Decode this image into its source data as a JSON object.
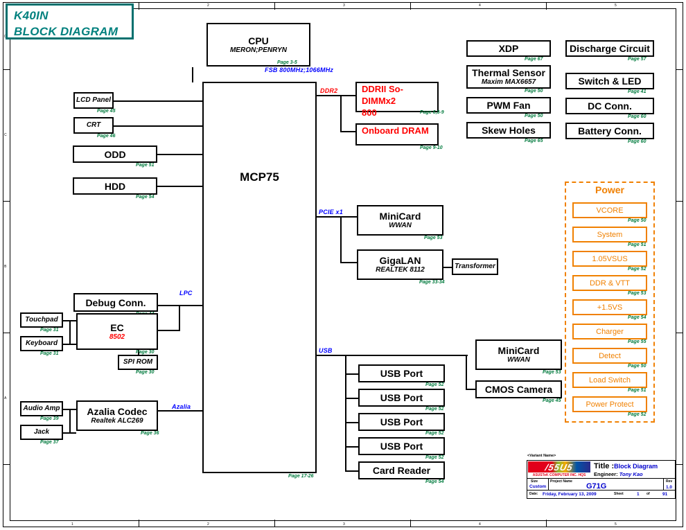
{
  "sheet": {
    "title_line1": "K40IN",
    "title_line2": "BLOCK DIAGRAM"
  },
  "blocks": {
    "cpu": {
      "name": "CPU",
      "sub": "MERON;PENRYN",
      "page": "Page 3-5"
    },
    "mcp75": {
      "name": "MCP75",
      "sub": "",
      "page": "Page 17-26"
    },
    "lcd_panel": {
      "name": "LCD Panel",
      "sub": "",
      "page": "Page 45"
    },
    "crt": {
      "name": "CRT",
      "sub": "",
      "page": "Page 46"
    },
    "odd": {
      "name": "ODD",
      "sub": "",
      "page": "Page 51"
    },
    "hdd": {
      "name": "HDD",
      "sub": "",
      "page": "Page 54"
    },
    "ddrii": {
      "name": "DDRII So-DIMMx2",
      "sub": "800",
      "page": "Page 6,8-9"
    },
    "onboard_dram": {
      "name": "Onboard DRAM",
      "sub": "",
      "page": "Page 9-10"
    },
    "xdp": {
      "name": "XDP",
      "sub": "",
      "page": "Page 67"
    },
    "thermal_sensor": {
      "name": "Thermal Sensor",
      "sub": "Maxim MAX6657",
      "page": "Page 50"
    },
    "pwm_fan": {
      "name": "PWM Fan",
      "sub": "",
      "page": "Page 50"
    },
    "skew_holes": {
      "name": "Skew Holes",
      "sub": "",
      "page": "Page 65"
    },
    "discharge": {
      "name": "Discharge Circuit",
      "sub": "",
      "page": "Page 57"
    },
    "switch_led": {
      "name": "Switch & LED",
      "sub": "",
      "page": "Page 41"
    },
    "dc_conn": {
      "name": "DC Conn.",
      "sub": "",
      "page": "Page 60"
    },
    "battery_conn": {
      "name": "Battery Conn.",
      "sub": "",
      "page": "Page 60"
    },
    "minicard_pcie": {
      "name": "MiniCard",
      "sub": "WWAN",
      "page": "Page 53"
    },
    "gigalan": {
      "name": "GigaLAN",
      "sub": "REALTEK 8112",
      "page": "Page 33-34"
    },
    "transformer": {
      "name": "Transformer",
      "sub": "",
      "page": ""
    },
    "debug_conn": {
      "name": "Debug Conn.",
      "sub": "",
      "page": "Page 44"
    },
    "touchpad": {
      "name": "Touchpad",
      "sub": "",
      "page": "Page 31"
    },
    "keyboard": {
      "name": "Keyboard",
      "sub": "",
      "page": "Page 31"
    },
    "ec": {
      "name": "EC",
      "sub": "8502",
      "page": "Page 30"
    },
    "spi_rom": {
      "name": "SPI ROM",
      "sub": "",
      "page": "Page 30"
    },
    "audio_amp": {
      "name": "Audio Amp",
      "sub": "",
      "page": "Page 39"
    },
    "jack": {
      "name": "Jack",
      "sub": "",
      "page": "Page 37"
    },
    "azalia_codec": {
      "name": "Azalia Codec",
      "sub": "Realtek ALC269",
      "page": "Page 36"
    },
    "minicard_usb": {
      "name": "MiniCard",
      "sub": "WWAN",
      "page": "Page 53"
    },
    "cmos_camera": {
      "name": "CMOS Camera",
      "sub": "",
      "page": "Page 45"
    },
    "usb_port_1": {
      "name": "USB Port",
      "sub": "",
      "page": "Page 52"
    },
    "usb_port_2": {
      "name": "USB Port",
      "sub": "",
      "page": "Page 52"
    },
    "usb_port_3": {
      "name": "USB Port",
      "sub": "",
      "page": "Page 52"
    },
    "usb_port_4": {
      "name": "USB Port",
      "sub": "",
      "page": "Page 52"
    },
    "card_reader": {
      "name": "Card Reader",
      "sub": "",
      "page": "Page 54"
    }
  },
  "bus_labels": {
    "fsb": "FSB 800MHz;1066MHz",
    "ddr2": "DDR2",
    "pcie": "PCIE x1",
    "lpc": "LPC",
    "usb": "USB",
    "azalia": "Azalia"
  },
  "power": {
    "title": "Power",
    "items": [
      {
        "label": "VCORE",
        "page": "Page 50"
      },
      {
        "label": "System",
        "page": "Page 51"
      },
      {
        "label": "1.05VSUS",
        "page": "Page 52"
      },
      {
        "label": "DDR & VTT",
        "page": "Page 53"
      },
      {
        "label": "+1.5VS",
        "page": "Page 54"
      },
      {
        "label": "Charger",
        "page": "Page 55"
      },
      {
        "label": "Detect",
        "page": "Page 50"
      },
      {
        "label": "Load Switch",
        "page": "Page 51"
      },
      {
        "label": "Power Protect",
        "page": "Page 52"
      }
    ]
  },
  "title_block": {
    "variant_name": "<Variant Name>",
    "company": "ASUSTeK COMPUTER INC. HQS",
    "logo_text": "/55U5",
    "title_label": "Title :",
    "title_value": "Block Diagram",
    "engineer_label": "Engineer:",
    "engineer_value": "Tony Kao",
    "size_label": "Size",
    "size_value": "Custom",
    "project_label": "Project Name",
    "project_value": "G71G",
    "rev_label": "Rev",
    "rev_value": "1.0",
    "date_label": "Date:",
    "date_value": "Friday, February 13, 2009",
    "sheet_label": "Sheet",
    "sheet_num": "1",
    "sheet_of": "of",
    "sheet_total": "91"
  },
  "zones": {
    "columns": [
      "1",
      "2",
      "3",
      "4",
      "5"
    ],
    "rows": [
      "D",
      "C",
      "B",
      "A"
    ]
  }
}
